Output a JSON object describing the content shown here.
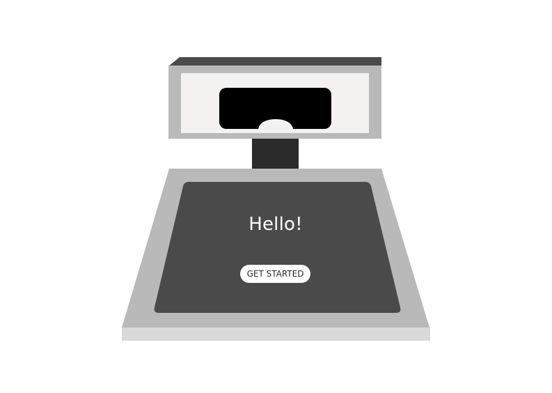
{
  "screen": {
    "greeting": "Hello!",
    "start_button_label": "GET STARTED"
  },
  "colors": {
    "camera_top": "#4a4a4a",
    "camera_frame": "#b9b9b9",
    "camera_face": "#f6f1f1",
    "camera_window": "#000000",
    "stand": "#2b2b2b",
    "base_frame": "#b9b9b9",
    "base_foot": "#d9d9d9",
    "screen": "#4a4a4a",
    "button_bg": "#ffffff"
  }
}
